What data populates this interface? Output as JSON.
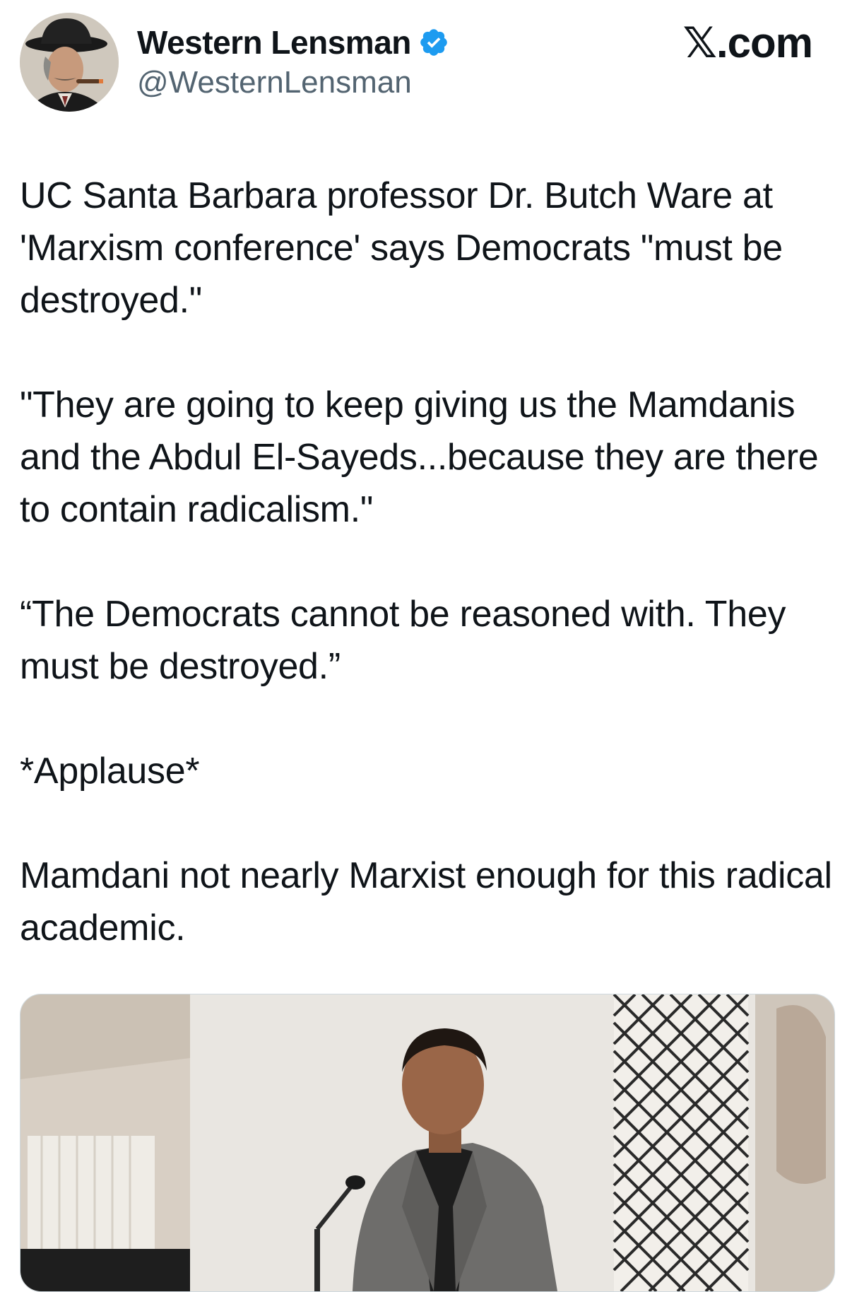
{
  "author": {
    "display_name": "Western Lensman",
    "handle": "@WesternLensman",
    "verified": true,
    "verified_icon": "verified-badge-icon",
    "avatar": "avatar-image"
  },
  "brand": {
    "label": "𝕏.com"
  },
  "tweet": {
    "paragraphs": [
      "UC Santa Barbara professor Dr. Butch Ware at 'Marxism conference' says Democrats \"must be destroyed.\"",
      "\"They are going to keep giving us the Mamdanis and the Abdul El-Sayeds...because they are there to contain radicalism.\"",
      "“The Democrats cannot be reasoned with. They must be destroyed.”",
      "*Applause*",
      "Mamdani not nearly Marxist enough for this radical academic."
    ]
  },
  "media": {
    "type": "video-thumbnail"
  },
  "colors": {
    "text": "#0f1419",
    "secondary": "#536471",
    "verified_blue": "#1d9bf0"
  }
}
